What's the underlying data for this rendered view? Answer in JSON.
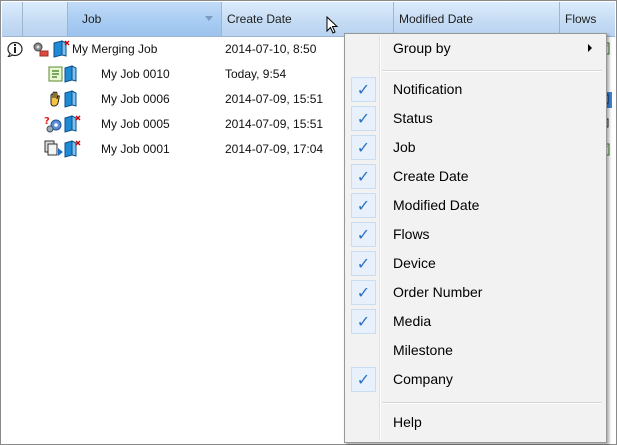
{
  "columns": {
    "job": "Job",
    "create_date": "Create Date",
    "modified_date": "Modified Date",
    "flows": "Flows"
  },
  "rows": [
    {
      "job": "My Merging Job",
      "create_date": "2014-07-10, 8:50",
      "icons": [
        "info-icon",
        "merge-job-icon",
        "job-document-icon"
      ]
    },
    {
      "job": "My Job 0010",
      "create_date": "Today, 9:54",
      "icons": [
        "green-document-icon",
        "job-document-icon"
      ]
    },
    {
      "job": "My Job 0006",
      "create_date": "2014-07-09, 15:51",
      "icons": [
        "hand-hold-icon",
        "job-document-icon"
      ]
    },
    {
      "job": "My Job 0005",
      "create_date": "2014-07-09, 15:51",
      "icons": [
        "error-gears-icon",
        "job-document-icon"
      ]
    },
    {
      "job": "My Job 0001",
      "create_date": "2014-07-09, 17:04",
      "icons": [
        "copy-process-icon",
        "job-document-icon"
      ]
    }
  ],
  "menu": {
    "group_by": "Group by",
    "items": [
      {
        "label": "Notification",
        "checked": true
      },
      {
        "label": "Status",
        "checked": true
      },
      {
        "label": "Job",
        "checked": true
      },
      {
        "label": "Create Date",
        "checked": true
      },
      {
        "label": "Modified Date",
        "checked": true
      },
      {
        "label": "Flows",
        "checked": true
      },
      {
        "label": "Device",
        "checked": true
      },
      {
        "label": "Order Number",
        "checked": true
      },
      {
        "label": "Media",
        "checked": true
      },
      {
        "label": "Milestone",
        "checked": false
      },
      {
        "label": "Company",
        "checked": true
      }
    ],
    "help": "Help",
    "check_glyph": "✓"
  },
  "colors": {
    "header_gradient_top": "#dcecfc",
    "header_selected": "#a9ccf2",
    "check_color": "#2b72c6",
    "menu_bg": "#f2f2f2"
  }
}
